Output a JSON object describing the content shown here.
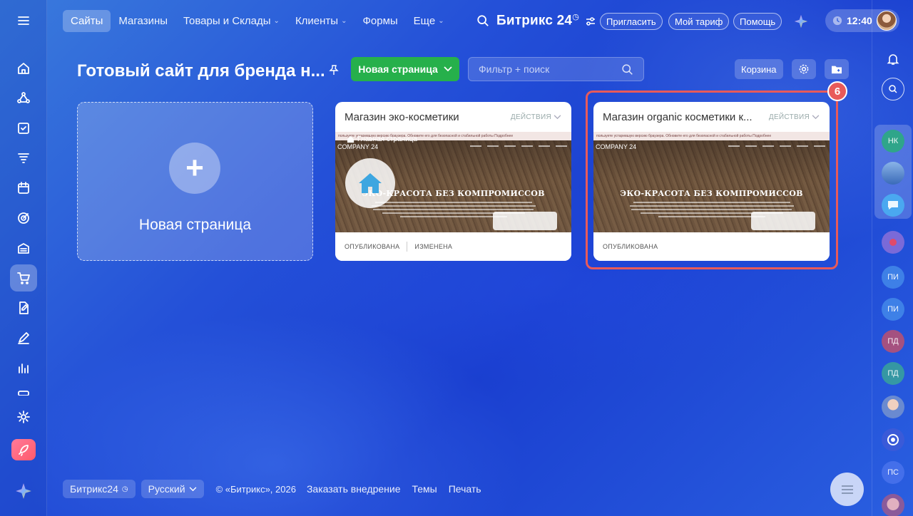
{
  "topnav": {
    "items": [
      {
        "label": "Сайты",
        "active": true,
        "dropdown": false
      },
      {
        "label": "Магазины",
        "active": false,
        "dropdown": false
      },
      {
        "label": "Товары и Склады",
        "active": false,
        "dropdown": true
      },
      {
        "label": "Клиенты",
        "active": false,
        "dropdown": true
      },
      {
        "label": "Формы",
        "active": false,
        "dropdown": false
      },
      {
        "label": "Еще",
        "active": false,
        "dropdown": true
      }
    ],
    "brand": "Битрикс",
    "brand_num": "24",
    "invite": "Пригласить",
    "tariff": "Мой тариф",
    "help": "Помощь",
    "time": "12:40"
  },
  "toolbar": {
    "title": "Готовый сайт для бренда н...",
    "new_page": "Новая страница",
    "search_placeholder": "Фильтр + поиск",
    "trash": "Корзина"
  },
  "new_card": {
    "label": "Новая страница"
  },
  "cards": [
    {
      "title": "Магазин эко-косметики",
      "actions": "Действия",
      "warning": "пользуете устаревшую версию браузера. Обновите его для безопасной и стабильной работы Подробнее",
      "company": "COMPANY 24",
      "headline": "ЭКО-КРАСОТА БЕЗ КОМПРОМИССОВ",
      "breadcrumb": "Главная страница",
      "status_published": "ОПУБЛИКОВАНА",
      "status_changed": "ИЗМЕНЕНА"
    },
    {
      "title": "Магазин organic косметики к...",
      "actions": "Действия",
      "warning": "пользуете устаревшую версию браузера. Обновите его для безопасной и стабильной работы Подробнее",
      "company": "COMPANY 24",
      "headline": "ЭКО-КРАСОТА БЕЗ КОМПРОМИССОВ",
      "status_published": "ОПУБЛИКОВАНА"
    }
  ],
  "annotation": {
    "badge": "6",
    "color": "#e85a5a"
  },
  "right_rail": {
    "avatars": [
      "НК",
      "ПИ",
      "ПИ",
      "ПД",
      "ПД",
      "ПС"
    ]
  },
  "footer": {
    "brand": "Битрикс24",
    "language": "Русский",
    "copyright": "© «Битрикс», 2026",
    "order": "Заказать внедрение",
    "themes": "Темы",
    "print": "Печать"
  },
  "colors": {
    "accent_green": "#26b04b",
    "highlight_red": "#e85a5a"
  }
}
